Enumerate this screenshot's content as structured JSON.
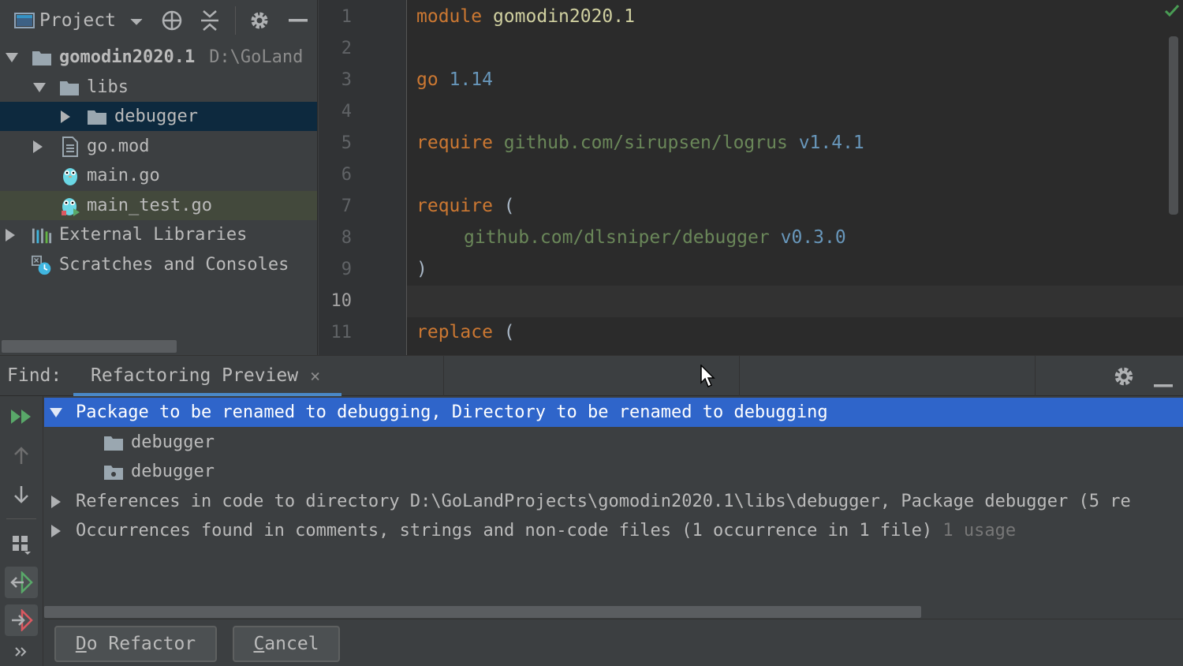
{
  "project_panel": {
    "title": "Project",
    "tree": [
      {
        "label": "gomodin2020.1",
        "path": "D:\\GoLand",
        "icon": "folder-icon"
      },
      {
        "label": "libs",
        "icon": "folder-icon"
      },
      {
        "label": "debugger",
        "icon": "folder-icon"
      },
      {
        "label": "go.mod",
        "icon": "gomod-file-icon"
      },
      {
        "label": "main.go",
        "icon": "gopher-icon"
      },
      {
        "label": "main_test.go",
        "icon": "gopher-test-icon"
      },
      {
        "label": "External Libraries",
        "icon": "library-icon"
      },
      {
        "label": "Scratches and Consoles",
        "icon": "scratches-icon"
      }
    ]
  },
  "editor": {
    "line_numbers": [
      "1",
      "2",
      "3",
      "4",
      "5",
      "6",
      "7",
      "8",
      "9",
      "10",
      "11"
    ],
    "current_line": "10",
    "code": {
      "l1_kw": "module",
      "l1_name": "gomodin2020.1",
      "l3_kw": "go",
      "l3_ver": "1.14",
      "l5_kw": "require",
      "l5_path": "github.com/sirupsen/logrus",
      "l5_ver": "v1.4.1",
      "l7_kw": "require",
      "l7_open": "(",
      "l8_path": "github.com/dlsniper/debugger",
      "l8_ver": "v0.3.0",
      "l9_close": ")",
      "l11_kw": "replace",
      "l11_open": "("
    }
  },
  "find": {
    "label": "Find:",
    "tab_label": "Refactoring Preview",
    "tab_close": "×",
    "results": {
      "group1": "Package to be renamed to debugging, Directory to be renamed to debugging",
      "item1": "debugger",
      "item2": "debugger",
      "group2": "References in code to directory D:\\GoLandProjects\\gomodin2020.1\\libs\\debugger, Package debugger (5 re",
      "group3": "Occurrences found in comments, strings and non-code files  (1 occurrence in 1 file)",
      "group3_usage": "1 usage"
    },
    "buttons": {
      "do_refactor_mnemonic": "D",
      "do_refactor_rest": "o Refactor",
      "cancel_mnemonic": "C",
      "cancel_rest": "ancel"
    }
  },
  "colors": {
    "selection_blue": "#2f65ca",
    "tab_underline": "#4a88c7",
    "keyword": "#cc7832",
    "string": "#6a8759",
    "number": "#6897bb"
  }
}
